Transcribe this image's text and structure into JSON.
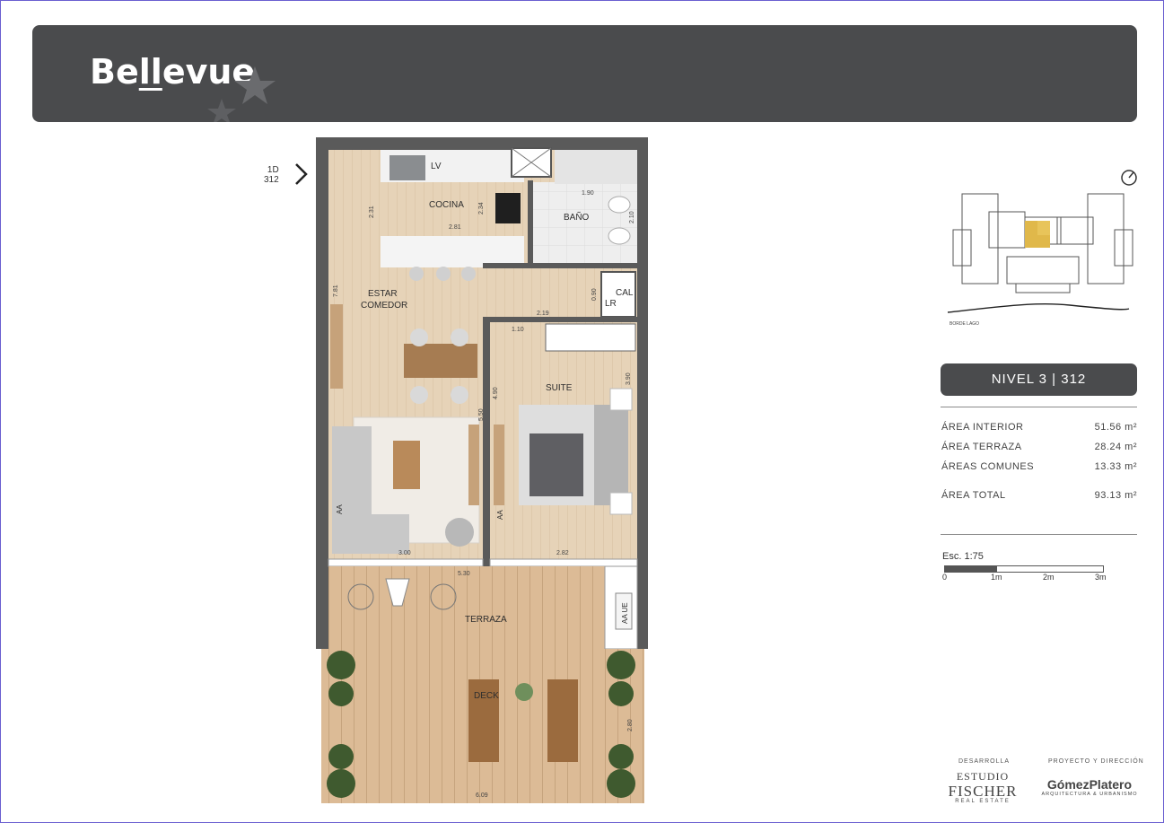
{
  "brand": {
    "name_part1": "Be",
    "name_underlined": "ll",
    "name_part2": "evue"
  },
  "unit_marker": {
    "line1": "1D",
    "line2": "312"
  },
  "rooms": {
    "cocina": "COCINA",
    "lv": "LV",
    "bano": "BAÑO",
    "cal": "CAL",
    "lr": "LR",
    "estar": "ESTAR",
    "comedor": "COMEDOR",
    "suite": "SUITE",
    "aa1": "AA",
    "aa2": "AA",
    "terraza": "TERRAZA",
    "aa_ue": "AA UE",
    "deck": "DECK"
  },
  "dimensions": {
    "d231": "2.31",
    "d281": "2.81",
    "d234": "2.34",
    "d190": "1.90",
    "d210": "2.10",
    "d781": "7.81",
    "d090": "0.90",
    "d219": "2.19",
    "d110": "1.10",
    "d490": "4.90",
    "d390": "3.90",
    "d550": "5.50",
    "d300": "3.00",
    "d282": "2.82",
    "d530": "5.30",
    "d280": "2.80",
    "d609": "6.09"
  },
  "keyplan": {
    "caption": "BORDE LAGO"
  },
  "level": {
    "label": "NIVEL 3 | 312"
  },
  "areas": [
    {
      "label": "ÁREA INTERIOR",
      "value": "51.56 m²"
    },
    {
      "label": "ÁREA TERRAZA",
      "value": "28.24 m²"
    },
    {
      "label": "ÁREAS COMUNES",
      "value": "13.33 m²"
    },
    {
      "label": "ÁREA TOTAL",
      "value": "93.13 m²"
    }
  ],
  "scale": {
    "label": "Esc. 1:75",
    "ticks": [
      "0",
      "1m",
      "2m",
      "3m"
    ]
  },
  "credits": {
    "developer_label": "DESARROLLA",
    "developer_line1": "ESTUDIO",
    "developer_line2": "FISCHER",
    "developer_line3": "REAL ESTATE",
    "architect_label": "PROYECTO Y DIRECCIÓN",
    "architect_name": "GómezPlatero",
    "architect_sub": "ARQUITECTURA & URBANISMO"
  },
  "colors": {
    "header_bg": "#4a4b4d",
    "floor_wood": "#e3cfb3",
    "deck_wood": "#d9b894",
    "wall": "#555555",
    "highlight": "#e0b84a"
  }
}
